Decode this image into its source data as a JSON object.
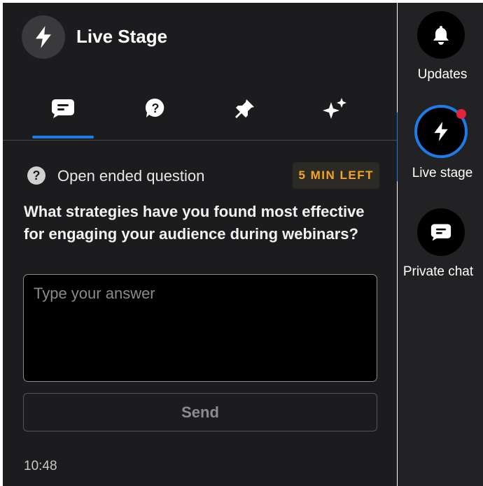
{
  "header": {
    "title": "Live Stage",
    "icon": "lightning-icon"
  },
  "tabs": [
    {
      "name": "chat",
      "icon": "chat-bubble-icon",
      "active": true
    },
    {
      "name": "qa",
      "icon": "question-bubble-icon",
      "active": false
    },
    {
      "name": "pinned",
      "icon": "pin-icon",
      "active": false
    },
    {
      "name": "highlights",
      "icon": "sparkles-icon",
      "active": false
    }
  ],
  "question": {
    "type_label": "Open ended question",
    "time_left": "5 MIN LEFT",
    "text": "What strategies have you found most effective for engaging your audience during webinars?",
    "answer_placeholder": "Type your answer",
    "answer_value": "",
    "send_label": "Send",
    "timestamp": "10:48"
  },
  "rail": {
    "items": [
      {
        "label": "Updates",
        "icon": "bell-icon"
      },
      {
        "label": "Live stage",
        "icon": "lightning-icon",
        "active": true,
        "has_notification": true
      },
      {
        "label": "Private chat",
        "icon": "chat-bubble-icon"
      }
    ]
  },
  "colors": {
    "accent": "#1e7ce8",
    "warning": "#f5a524",
    "notification": "#e0243a",
    "panel_bg": "#1c1c1e"
  }
}
